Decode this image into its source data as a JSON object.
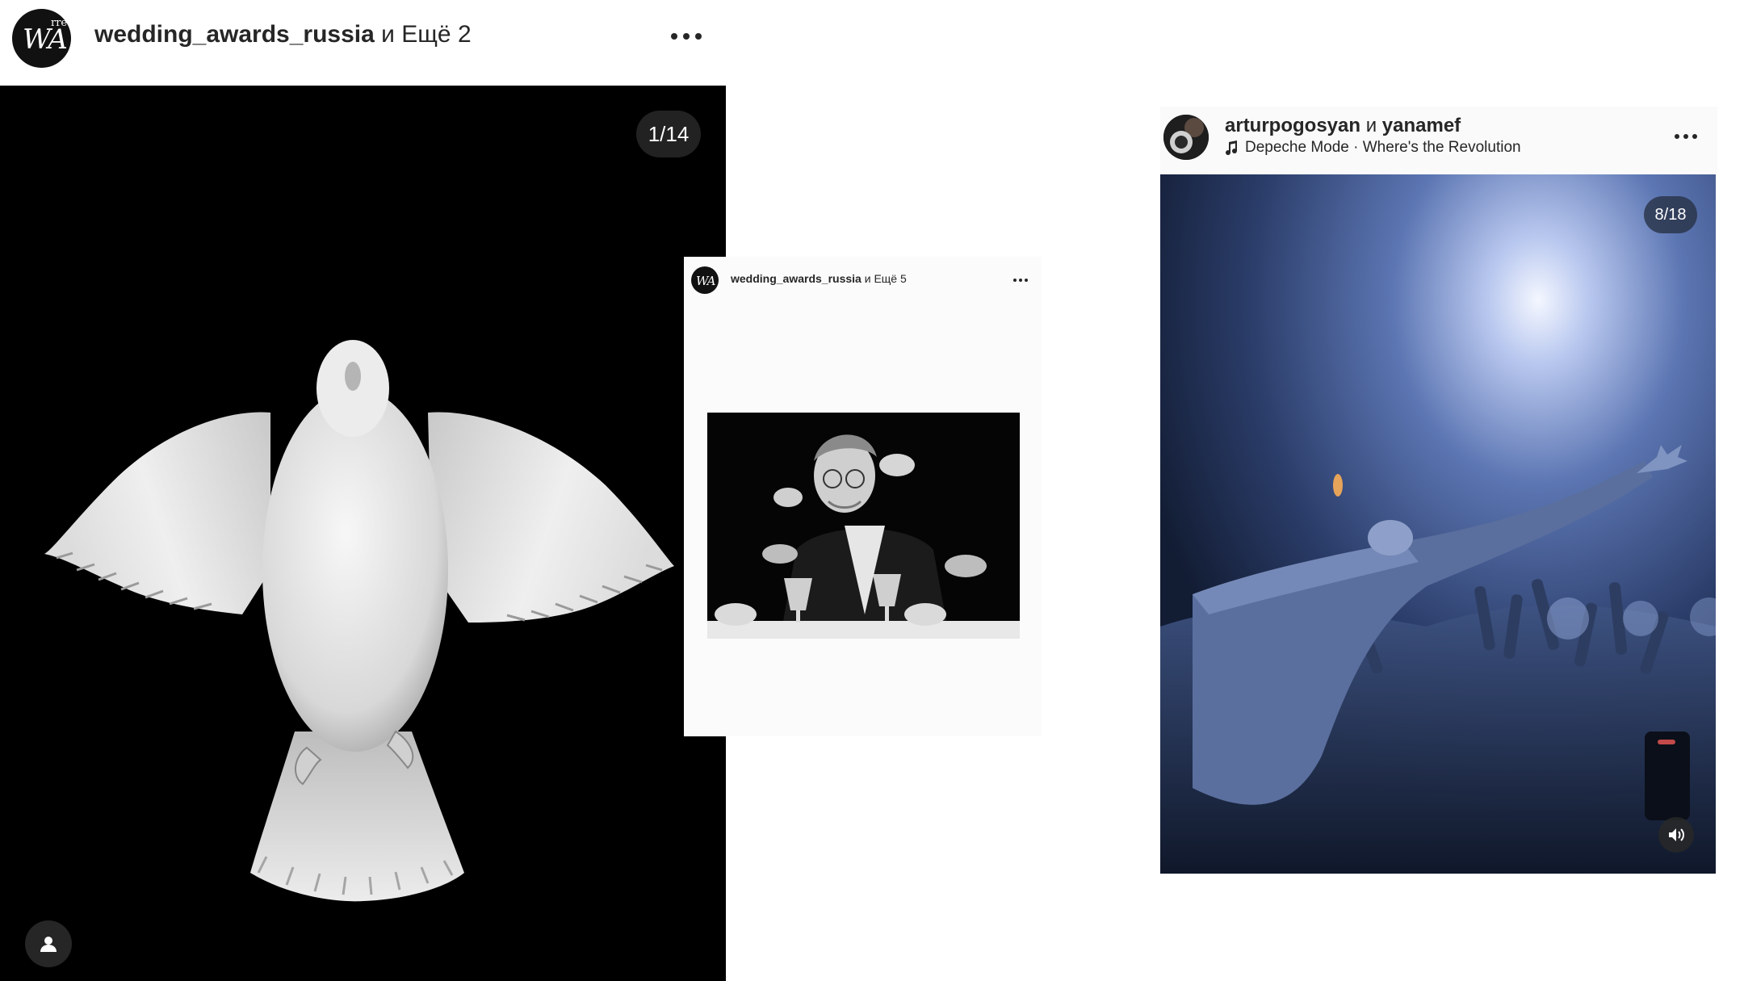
{
  "posts": [
    {
      "author_bold": "wedding_awards_russia",
      "author_rest": " и Ещё 2",
      "avatar_monogram": "WA",
      "avatar_superscript": "rre",
      "counter": "1/14"
    },
    {
      "author_bold": "wedding_awards_russia",
      "author_rest": " и Ещё 5",
      "avatar_monogram": "WA"
    },
    {
      "author_bold": "arturpogosyan",
      "author_mid": " и ",
      "author_bold2": "yanamef",
      "music": "Depeche Mode · Where's the Revolution",
      "counter": "8/18"
    }
  ],
  "icons": {
    "more": "more-options-icon",
    "user_tag": "user-tag-icon",
    "music": "music-note-icon",
    "sound": "speaker-sound-icon"
  }
}
